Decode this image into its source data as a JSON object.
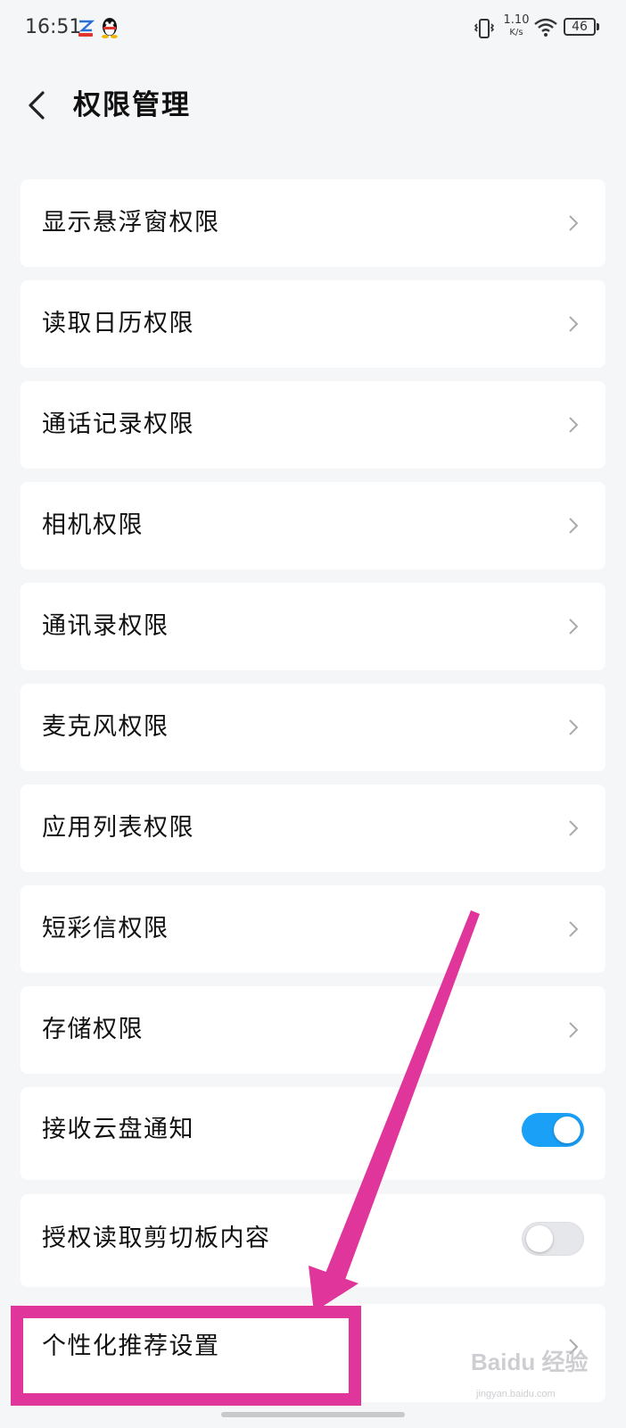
{
  "status_bar": {
    "time": "16:51",
    "net_speed_value": "1.10",
    "net_speed_unit": "K/s",
    "battery": "46",
    "icons": [
      "cloud-app-icon",
      "qq-penguin-icon",
      "vibrate-icon",
      "wifi-icon",
      "battery-icon"
    ]
  },
  "header": {
    "back_icon": "chevron-left-icon",
    "title": "权限管理"
  },
  "items": [
    {
      "label": "显示悬浮窗权限",
      "control": "chevron"
    },
    {
      "label": "读取日历权限",
      "control": "chevron"
    },
    {
      "label": "通话记录权限",
      "control": "chevron"
    },
    {
      "label": "相机权限",
      "control": "chevron"
    },
    {
      "label": "通讯录权限",
      "control": "chevron"
    },
    {
      "label": "麦克风权限",
      "control": "chevron"
    },
    {
      "label": "应用列表权限",
      "control": "chevron"
    },
    {
      "label": "短彩信权限",
      "control": "chevron"
    },
    {
      "label": "存储权限",
      "control": "chevron"
    },
    {
      "label": "接收云盘通知",
      "control": "toggle",
      "enabled": true
    },
    {
      "label": "授权读取剪切板内容",
      "control": "toggle",
      "enabled": false
    },
    {
      "label": "个性化推荐设置",
      "control": "chevron"
    }
  ],
  "annotation": {
    "color": "#e0359b",
    "type": "arrow-and-box",
    "target": "个性化推荐设置"
  },
  "watermark": {
    "main": "Baidu 经验",
    "sub": "jingyan.baidu.com"
  },
  "colors": {
    "background": "#f5f6f8",
    "card": "#ffffff",
    "toggle_on": "#1aa0f7",
    "toggle_off": "#e6e7ea"
  }
}
